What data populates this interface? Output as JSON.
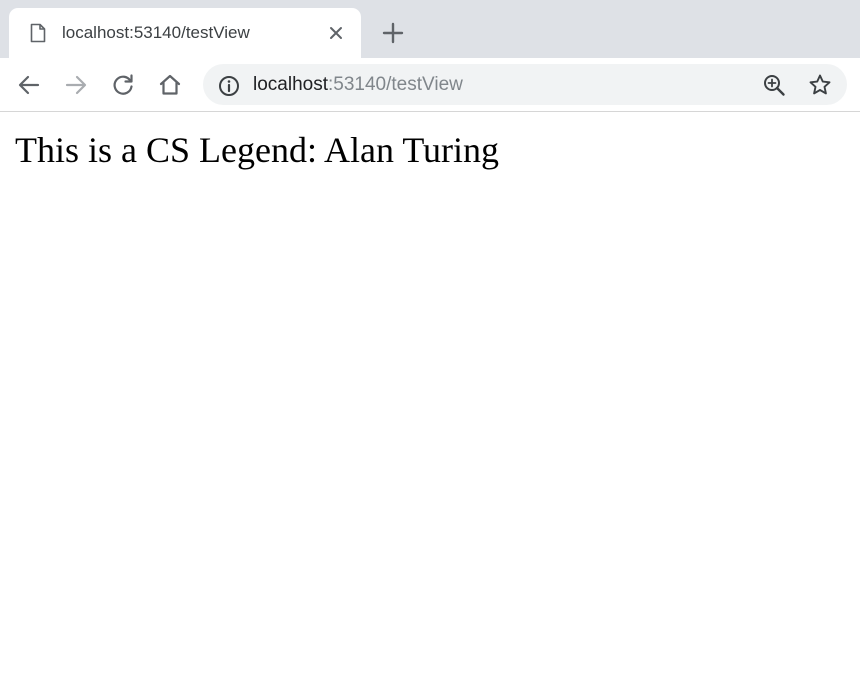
{
  "browser": {
    "tab": {
      "title": "localhost:53140/testView",
      "favicon": "page-icon",
      "close_icon": "close-icon"
    },
    "new_tab_icon": "plus-icon",
    "toolbar": {
      "back_icon": "back-arrow-icon",
      "forward_icon": "forward-arrow-icon",
      "reload_icon": "reload-icon",
      "home_icon": "home-icon",
      "info_icon": "info-icon",
      "zoom_icon": "zoom-in-icon",
      "bookmark_icon": "star-icon"
    },
    "address_bar": {
      "host": "localhost",
      "rest": ":53140/testView"
    },
    "colors": {
      "tabstrip_bg": "#dee1e6",
      "omnibox_bg": "#f1f3f4",
      "icon": "#5f6368",
      "disabled_icon": "#a9acb0"
    }
  },
  "page": {
    "heading": "This is a CS Legend: Alan Turing"
  }
}
